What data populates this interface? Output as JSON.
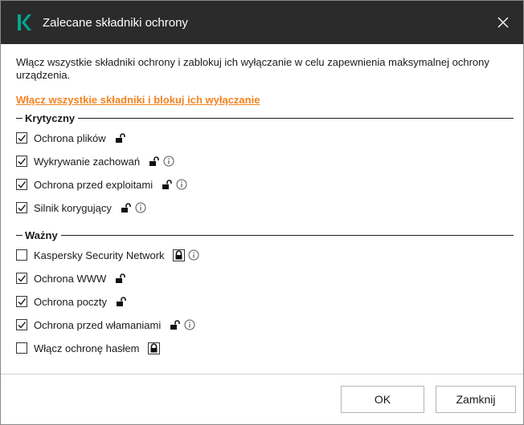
{
  "dialog": {
    "title": "Zalecane składniki ochrony",
    "logo_icon": "kaspersky-k-logo",
    "logo_color": "#00a88e",
    "close_icon": "close-icon"
  },
  "description": "Włącz wszystkie składniki ochrony i zablokuj ich wyłączanie w celu zapewnienia maksymalnej ochrony urządzenia.",
  "enable_all_link": "Włącz wszystkie składniki i blokuj ich wyłączanie",
  "link_color": "#f58220",
  "groups": [
    {
      "title": "Krytyczny",
      "items": [
        {
          "label": "Ochrona plików",
          "checked": true,
          "lock": "unlocked",
          "info": false
        },
        {
          "label": "Wykrywanie zachowań",
          "checked": true,
          "lock": "unlocked",
          "info": true
        },
        {
          "label": "Ochrona przed exploitami",
          "checked": true,
          "lock": "unlocked",
          "info": true
        },
        {
          "label": "Silnik korygujący",
          "checked": true,
          "lock": "unlocked",
          "info": true
        }
      ]
    },
    {
      "title": "Ważny",
      "items": [
        {
          "label": "Kaspersky Security Network",
          "checked": false,
          "lock": "locked",
          "info": true
        },
        {
          "label": "Ochrona WWW",
          "checked": true,
          "lock": "unlocked",
          "info": false
        },
        {
          "label": "Ochrona poczty",
          "checked": true,
          "lock": "unlocked",
          "info": false
        },
        {
          "label": "Ochrona przed włamaniami",
          "checked": true,
          "lock": "unlocked",
          "info": true
        },
        {
          "label": "Włącz ochronę hasłem",
          "checked": false,
          "lock": "locked",
          "info": false
        }
      ]
    }
  ],
  "buttons": {
    "ok": "OK",
    "close": "Zamknij"
  }
}
